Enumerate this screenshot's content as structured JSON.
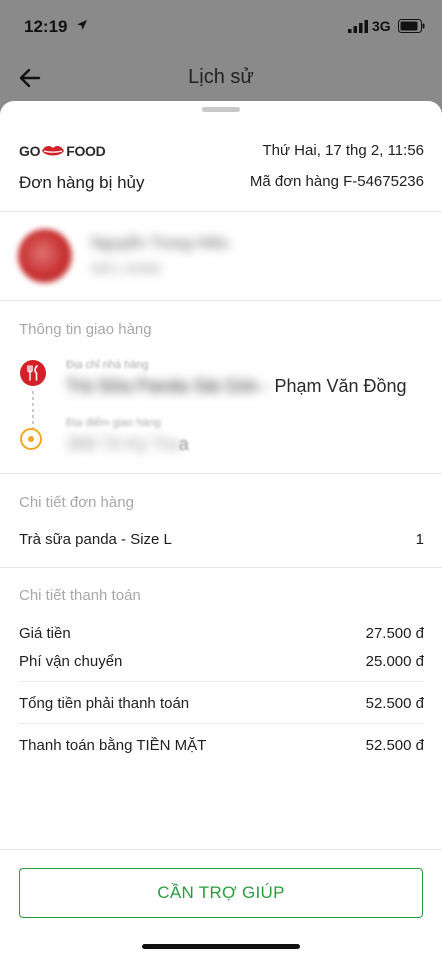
{
  "status_bar": {
    "time": "12:19",
    "network": "3G"
  },
  "header": {
    "title": "Lịch sử"
  },
  "order": {
    "brand": {
      "left": "GO",
      "right": "FOOD"
    },
    "date": "Thứ Hai, 17 thg 2, 11:56",
    "status": "Đơn hàng bị hủy",
    "order_id": "Mã đơn hàng F-54675236"
  },
  "driver": {
    "name": "Nguyễn Trọng Hiếu",
    "sub": "59F1 32456"
  },
  "delivery": {
    "section_title": "Thông tin giao hàng",
    "restaurant_label": "Địa chỉ nhà hàng",
    "restaurant_value_hidden": "Trà Sữa Panda Sài Gòn -",
    "restaurant_value_visible": " Phạm Văn Đồng",
    "destination_label": "Địa điểm giao hàng",
    "destination_value_hidden": "368 Tô Ký Tra",
    "destination_value_visible": "a"
  },
  "order_details": {
    "section_title": "Chi tiết đơn hàng",
    "items": [
      {
        "name": "Trà sữa panda - Size L",
        "qty": "1"
      }
    ]
  },
  "payment": {
    "section_title": "Chi tiết thanh toán",
    "rows": [
      {
        "label": "Giá tiền",
        "value": "27.500 đ"
      },
      {
        "label": "Phí vận chuyển",
        "value": "25.000 đ"
      },
      {
        "label": "Tổng tiền phải thanh toán",
        "value": "52.500 đ"
      },
      {
        "label": "Thanh toán bằng TIỀN MẶT",
        "value": "52.500 đ"
      }
    ]
  },
  "help_button": {
    "label": "CẦN TRỢ GIÚP"
  },
  "colors": {
    "accent_green": "#2a9d3f",
    "gojek_red": "#d32029",
    "destination_orange": "#f5a623"
  }
}
